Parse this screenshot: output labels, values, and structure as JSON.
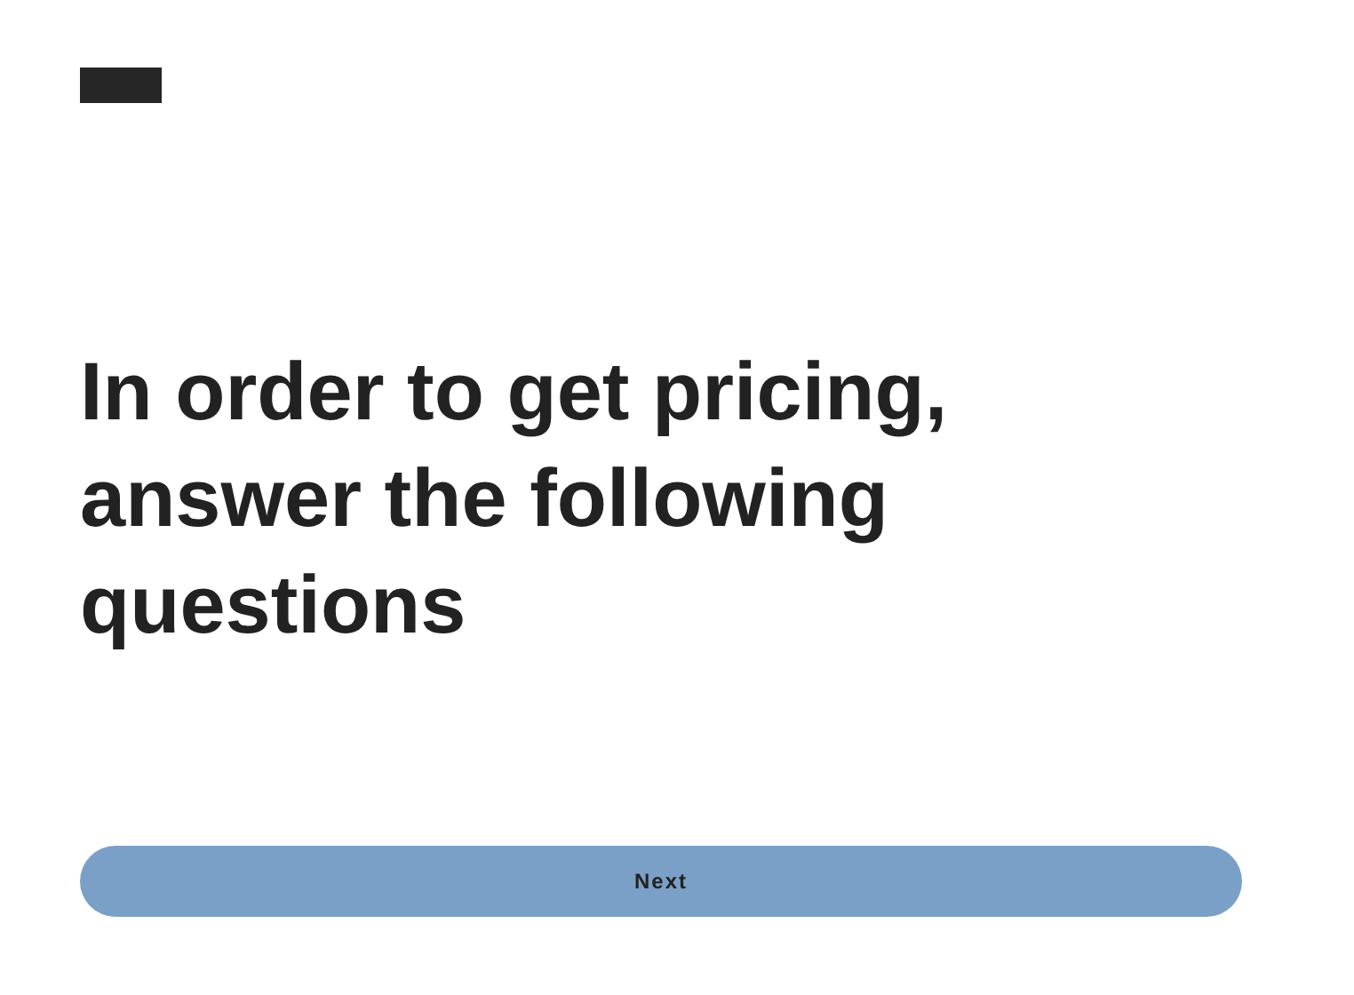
{
  "heading": "In order to get pricing, answer the following questions",
  "button": {
    "label": "Next"
  }
}
